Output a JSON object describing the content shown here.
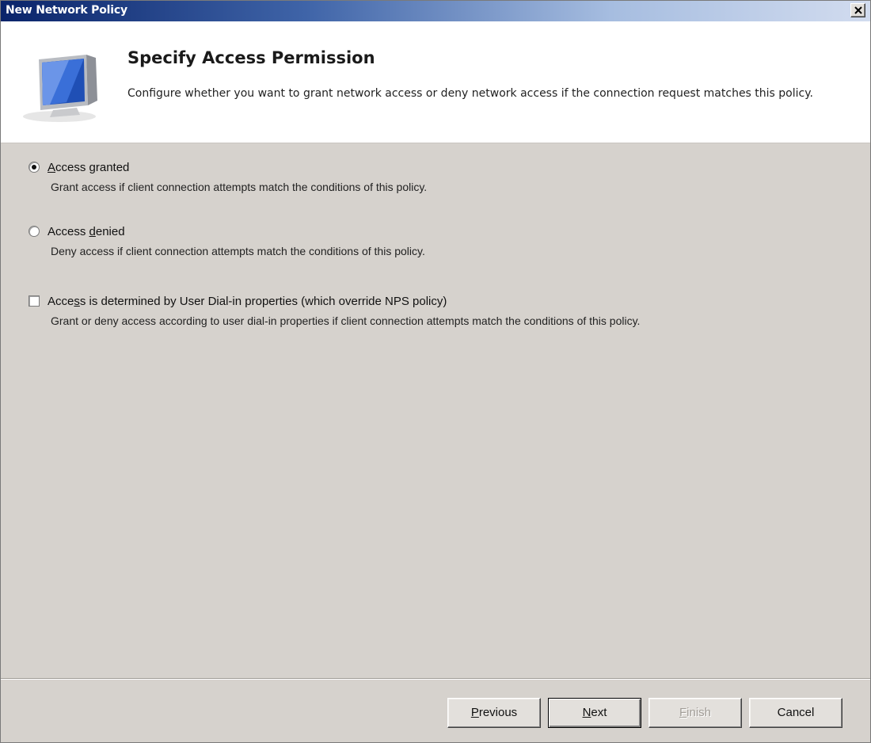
{
  "window": {
    "title": "New Network Policy",
    "close_icon": "close-icon"
  },
  "header": {
    "title": "Specify Access Permission",
    "description": "Configure whether you want to grant network access or deny network access if the connection request matches this policy.",
    "icon": "network-computer-icon"
  },
  "options": {
    "access_granted": {
      "label": "Access granted",
      "accelerator": "A",
      "description": "Grant access if client connection attempts match the conditions of this policy.",
      "checked": true
    },
    "access_denied": {
      "label_prefix": "Access ",
      "accelerator": "d",
      "label_suffix": "enied",
      "label": "Access denied",
      "description": "Deny access if client connection attempts match the conditions of this policy.",
      "checked": false
    },
    "dialin": {
      "label_prefix": "Acce",
      "accelerator": "s",
      "label_suffix": "s is determined by User Dial-in properties (which override NPS policy)",
      "label": "Access is determined by User Dial-in properties (which override NPS policy)",
      "description": "Grant or deny access according to user dial-in properties if client connection attempts match the conditions of this policy.",
      "checked": false
    }
  },
  "buttons": {
    "previous": {
      "accelerator": "P",
      "rest": "revious",
      "label": "Previous"
    },
    "next": {
      "accelerator": "N",
      "rest": "ext",
      "label": "Next"
    },
    "finish": {
      "accelerator": "F",
      "rest": "inish",
      "label": "Finish",
      "enabled": false
    },
    "cancel": {
      "label": "Cancel"
    }
  },
  "colors": {
    "title_bar_start": "#0a246a",
    "title_bar_end": "#d2dcef",
    "dialog_bg": "#d6d2cd",
    "header_bg": "#ffffff"
  }
}
